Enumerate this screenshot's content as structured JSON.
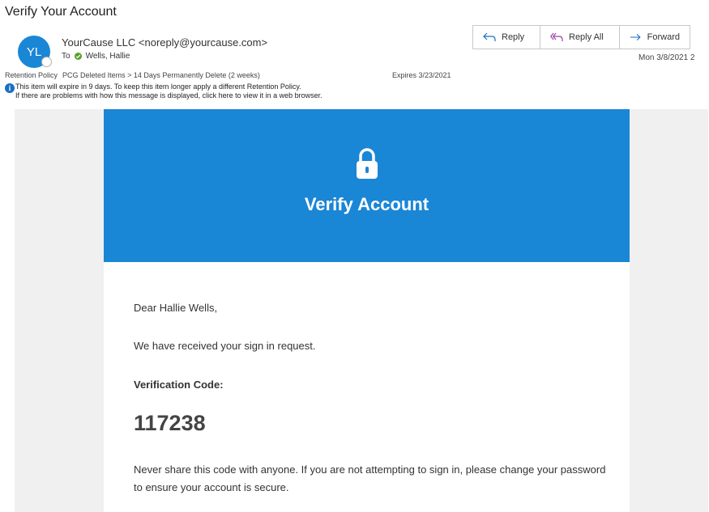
{
  "subject": "Verify Your Account",
  "sender": {
    "initials": "YL",
    "display": "YourCause LLC <noreply@yourcause.com>"
  },
  "recipient": {
    "to_label": "To",
    "name": "Wells, Hallie"
  },
  "actions": {
    "reply": "Reply",
    "reply_all": "Reply All",
    "forward": "Forward"
  },
  "date": "Mon 3/8/2021 2",
  "retention": {
    "label": "Retention Policy",
    "policy": "PCG Deleted Items > 14 Days Permanently Delete (2 weeks)",
    "expires": "Expires  3/23/2021",
    "info_line1": "This item will expire in 9 days. To keep this item longer apply a different Retention Policy.",
    "info_line2": "If there are problems with how this message is displayed, click here to view it in a web browser."
  },
  "email": {
    "banner_title": "Verify Account",
    "greeting": "Dear Hallie Wells,",
    "received": "We have received your sign in request.",
    "code_label": "Verification Code:",
    "code": "117238",
    "warning": "Never share this code with anyone. If you are not attempting to sign in, please change your password to ensure your account is secure."
  },
  "colors": {
    "accent": "#1a86d6",
    "presence_ok": "#5aa02c",
    "reading_pane_bg": "#f0f0f0"
  }
}
